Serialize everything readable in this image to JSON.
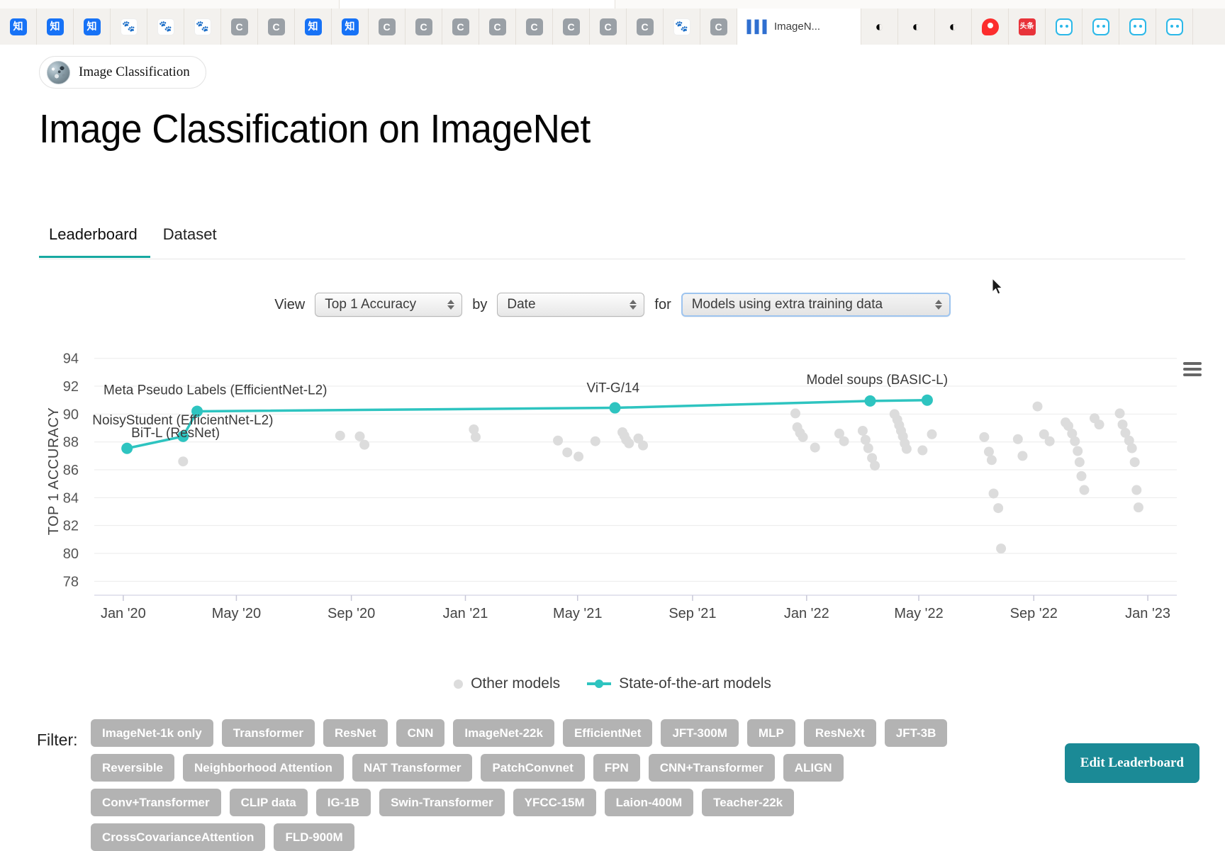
{
  "browser": {
    "tabs": [
      {
        "icon": "zhihu-icon",
        "type": "zhihu",
        "label": ""
      },
      {
        "icon": "zhihu-icon",
        "type": "zhihu",
        "label": ""
      },
      {
        "icon": "zhihu-icon",
        "type": "zhihu",
        "label": ""
      },
      {
        "icon": "baidu-icon",
        "type": "baidu",
        "label": ""
      },
      {
        "icon": "baidu-icon",
        "type": "baidu",
        "label": ""
      },
      {
        "icon": "baidu-icon",
        "type": "baidu",
        "label": ""
      },
      {
        "icon": "csdn-icon",
        "type": "c",
        "label": ""
      },
      {
        "icon": "csdn-icon",
        "type": "c",
        "label": ""
      },
      {
        "icon": "zhihu-icon",
        "type": "zhihu",
        "label": ""
      },
      {
        "icon": "zhihu-icon",
        "type": "zhihu",
        "label": ""
      },
      {
        "icon": "csdn-icon",
        "type": "c",
        "label": ""
      },
      {
        "icon": "csdn-icon",
        "type": "c",
        "label": ""
      },
      {
        "icon": "csdn-icon",
        "type": "c",
        "label": ""
      },
      {
        "icon": "csdn-icon",
        "type": "c",
        "label": ""
      },
      {
        "icon": "csdn-icon",
        "type": "c",
        "label": ""
      },
      {
        "icon": "csdn-icon",
        "type": "c",
        "label": ""
      },
      {
        "icon": "csdn-icon",
        "type": "c",
        "label": ""
      },
      {
        "icon": "csdn-icon",
        "type": "c",
        "label": ""
      },
      {
        "icon": "baidu-icon",
        "type": "baidu",
        "label": ""
      },
      {
        "icon": "csdn-icon",
        "type": "c",
        "label": ""
      }
    ],
    "active_tab": {
      "icon": "paperswithcode-icon",
      "label": "ImageN..."
    },
    "right_tabs": [
      {
        "type": "cmoon"
      },
      {
        "type": "cmoon"
      },
      {
        "type": "cmoon"
      },
      {
        "type": "red"
      },
      {
        "type": "toutiao"
      },
      {
        "type": "bili"
      },
      {
        "type": "bili"
      },
      {
        "type": "bili"
      },
      {
        "type": "bili"
      }
    ]
  },
  "breadcrumb": {
    "label": "Image Classification"
  },
  "header": {
    "title": "Image Classification on ImageNet"
  },
  "tabs": [
    {
      "label": "Leaderboard",
      "selected": true
    },
    {
      "label": "Dataset",
      "selected": false
    }
  ],
  "controls": {
    "view_label": "View",
    "by_label": "by",
    "for_label": "for",
    "metric": "Top 1 Accuracy",
    "axis": "Date",
    "filter": "Models using extra training data"
  },
  "chart_menu_icon": "hamburger-menu-icon",
  "legend": [
    {
      "label": "Other models",
      "marker": "dot",
      "color": "#dcdcdc"
    },
    {
      "label": "State-of-the-art models",
      "marker": "line-dot",
      "color": "#2ec4c0"
    }
  ],
  "filter": {
    "label": "Filter:",
    "chips": [
      "ImageNet-1k only",
      "Transformer",
      "ResNet",
      "CNN",
      "ImageNet-22k",
      "EfficientNet",
      "JFT-300M",
      "MLP",
      "ResNeXt",
      "JFT-3B",
      "Reversible",
      "Neighborhood Attention",
      "NAT Transformer",
      "PatchConvnet",
      "FPN",
      "CNN+Transformer",
      "ALIGN",
      "Conv+Transformer",
      "CLIP data",
      "IG-1B",
      "Swin-Transformer",
      "YFCC-15M",
      "Laion-400M",
      "Teacher-22k",
      "CrossCovarianceAttention",
      "FLD-900M"
    ],
    "edit_button": "Edit Leaderboard"
  },
  "chart_data": {
    "type": "scatter",
    "title": "",
    "xlabel": "",
    "ylabel": "TOP 1 ACCURACY",
    "ylim": [
      77.0,
      94.8
    ],
    "yticks": [
      78,
      80,
      82,
      84,
      86,
      88,
      90,
      92,
      94
    ],
    "xlim": [
      "2019-12-01",
      "2023-02-01"
    ],
    "xticks": [
      "Jan '20",
      "May '20",
      "Sep '20",
      "Jan '21",
      "May '21",
      "Sep '21",
      "Jan '22",
      "May '22",
      "Sep '22",
      "Jan '23"
    ],
    "grid": true,
    "legend_position": "bottom-center",
    "accent_color": "#2ec4c0",
    "other_color": "#dcdcdc",
    "series": [
      {
        "name": "State-of-the-art models",
        "type": "line",
        "color": "#2ec4c0",
        "points": [
          {
            "x": "2020-01-05",
            "y": 87.54,
            "label": "BiT-L (ResNet)"
          },
          {
            "x": "2020-03-05",
            "y": 88.4,
            "label": "NoisyStudent (EfficientNet-L2)"
          },
          {
            "x": "2020-03-20",
            "y": 90.2,
            "label": "Meta Pseudo Labels (EfficientNet-L2)"
          },
          {
            "x": "2021-06-10",
            "y": 90.45,
            "label": "ViT-G/14"
          },
          {
            "x": "2022-03-10",
            "y": 90.94,
            "label": "Model soups (BASIC-L)"
          },
          {
            "x": "2022-05-10",
            "y": 91.0,
            "label": ""
          }
        ]
      },
      {
        "name": "Other models",
        "type": "scatter",
        "color": "#dcdcdc",
        "points": [
          {
            "x": "2020-03-05",
            "y": 86.6
          },
          {
            "x": "2020-08-20",
            "y": 88.45
          },
          {
            "x": "2020-09-10",
            "y": 88.4
          },
          {
            "x": "2020-09-15",
            "y": 87.8
          },
          {
            "x": "2021-01-10",
            "y": 88.9
          },
          {
            "x": "2021-01-12",
            "y": 88.35
          },
          {
            "x": "2021-04-10",
            "y": 88.1
          },
          {
            "x": "2021-04-20",
            "y": 87.25
          },
          {
            "x": "2021-05-02",
            "y": 86.95
          },
          {
            "x": "2021-05-20",
            "y": 88.05
          },
          {
            "x": "2021-06-18",
            "y": 88.7
          },
          {
            "x": "2021-06-20",
            "y": 88.45
          },
          {
            "x": "2021-06-22",
            "y": 88.15
          },
          {
            "x": "2021-06-25",
            "y": 87.9
          },
          {
            "x": "2021-07-05",
            "y": 88.25
          },
          {
            "x": "2021-07-10",
            "y": 87.75
          },
          {
            "x": "2021-12-20",
            "y": 90.05
          },
          {
            "x": "2021-12-22",
            "y": 89.05
          },
          {
            "x": "2021-12-25",
            "y": 88.65
          },
          {
            "x": "2021-12-28",
            "y": 88.35
          },
          {
            "x": "2022-01-10",
            "y": 87.6
          },
          {
            "x": "2022-02-05",
            "y": 88.6
          },
          {
            "x": "2022-02-10",
            "y": 88.05
          },
          {
            "x": "2022-03-02",
            "y": 88.8
          },
          {
            "x": "2022-03-05",
            "y": 88.15
          },
          {
            "x": "2022-03-08",
            "y": 87.55
          },
          {
            "x": "2022-03-12",
            "y": 86.85
          },
          {
            "x": "2022-03-15",
            "y": 86.3
          },
          {
            "x": "2022-04-05",
            "y": 90.0
          },
          {
            "x": "2022-04-08",
            "y": 89.6
          },
          {
            "x": "2022-04-10",
            "y": 89.2
          },
          {
            "x": "2022-04-12",
            "y": 88.8
          },
          {
            "x": "2022-04-14",
            "y": 88.4
          },
          {
            "x": "2022-04-16",
            "y": 87.9
          },
          {
            "x": "2022-04-18",
            "y": 87.5
          },
          {
            "x": "2022-05-05",
            "y": 87.4
          },
          {
            "x": "2022-05-15",
            "y": 88.55
          },
          {
            "x": "2022-07-10",
            "y": 88.35
          },
          {
            "x": "2022-07-15",
            "y": 87.3
          },
          {
            "x": "2022-07-18",
            "y": 86.7
          },
          {
            "x": "2022-07-20",
            "y": 84.3
          },
          {
            "x": "2022-07-25",
            "y": 83.25
          },
          {
            "x": "2022-07-28",
            "y": 80.35
          },
          {
            "x": "2022-08-15",
            "y": 88.2
          },
          {
            "x": "2022-08-20",
            "y": 87.0
          },
          {
            "x": "2022-09-05",
            "y": 90.55
          },
          {
            "x": "2022-09-12",
            "y": 88.55
          },
          {
            "x": "2022-09-18",
            "y": 88.05
          },
          {
            "x": "2022-10-05",
            "y": 89.4
          },
          {
            "x": "2022-10-08",
            "y": 89.15
          },
          {
            "x": "2022-10-12",
            "y": 88.6
          },
          {
            "x": "2022-10-15",
            "y": 88.05
          },
          {
            "x": "2022-10-18",
            "y": 87.35
          },
          {
            "x": "2022-10-20",
            "y": 86.55
          },
          {
            "x": "2022-10-22",
            "y": 85.55
          },
          {
            "x": "2022-10-25",
            "y": 84.55
          },
          {
            "x": "2022-11-05",
            "y": 89.7
          },
          {
            "x": "2022-11-10",
            "y": 89.25
          },
          {
            "x": "2022-12-02",
            "y": 90.05
          },
          {
            "x": "2022-12-05",
            "y": 89.25
          },
          {
            "x": "2022-12-08",
            "y": 88.65
          },
          {
            "x": "2022-12-12",
            "y": 88.1
          },
          {
            "x": "2022-12-15",
            "y": 87.55
          },
          {
            "x": "2022-12-18",
            "y": 86.55
          },
          {
            "x": "2022-12-20",
            "y": 84.55
          },
          {
            "x": "2022-12-22",
            "y": 83.3
          }
        ]
      }
    ]
  }
}
